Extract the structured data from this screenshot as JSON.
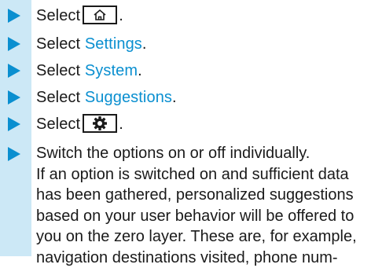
{
  "steps": [
    {
      "prefix": "Select",
      "suffix": ".",
      "icon": "home-icon"
    },
    {
      "prefix": "Select ",
      "link": "Settings",
      "suffix": "."
    },
    {
      "prefix": "Select ",
      "link": "System",
      "suffix": "."
    },
    {
      "prefix": "Select ",
      "link": "Suggestions",
      "suffix": "."
    },
    {
      "prefix": "Select",
      "suffix": ".",
      "icon": "gear-icon"
    }
  ],
  "final_step": {
    "lines": [
      "Switch the options on or off individually.",
      "If an option is switched on and sufficient data",
      "has been gathered, personalized suggestions",
      "based on your user behavior will be offered to",
      "you on the zero layer. These are, for example,",
      "navigation destinations visited, phone num-"
    ]
  },
  "colors": {
    "accent": "#0a8fd0",
    "gutter": "#cce8f6",
    "text": "#1a1a1a"
  }
}
